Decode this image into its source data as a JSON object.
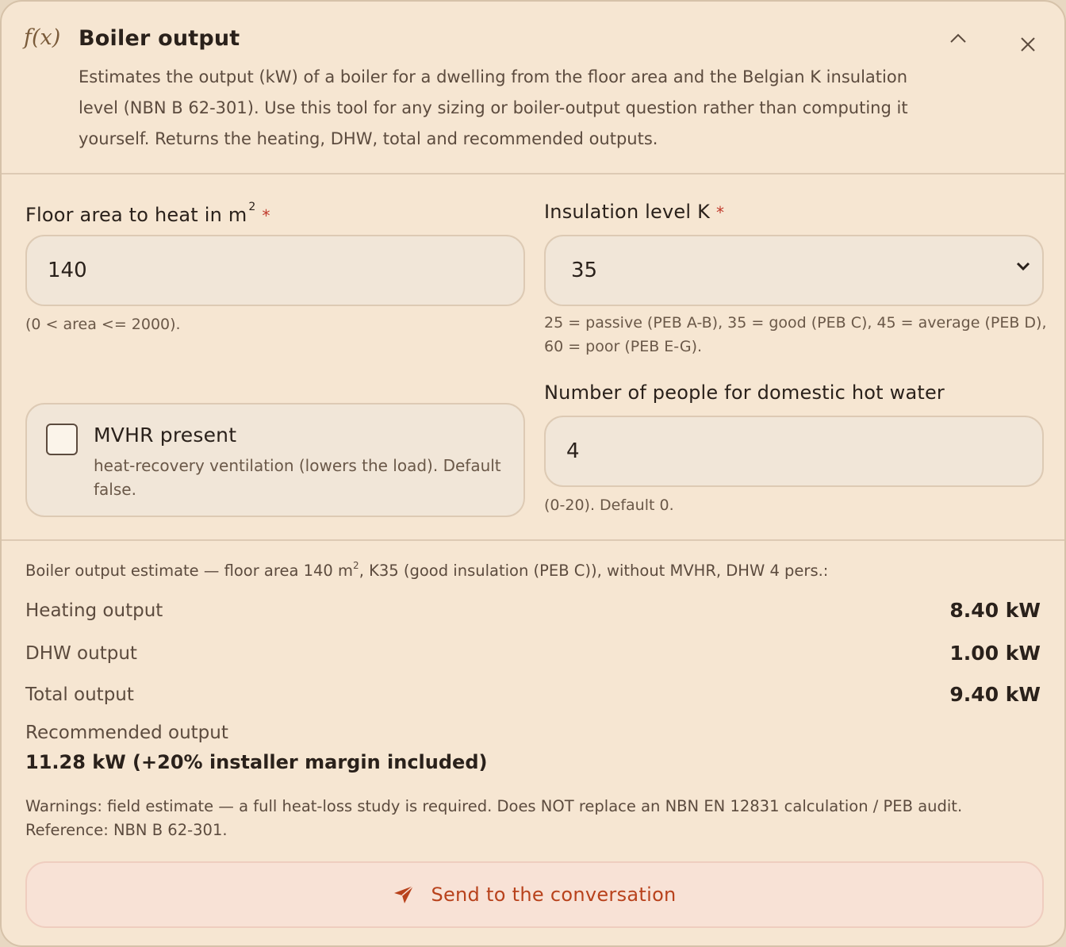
{
  "header": {
    "fx": "f(x)",
    "title": "Boiler output",
    "description": "Estimates the output (kW) of a boiler for a dwelling from the floor area and the Belgian K insulation level (NBN B 62-301). Use this tool for any sizing or boiler-output question rather than computing it yourself. Returns the heating, DHW, total and recommended outputs.",
    "collapse_icon": "chevron-up-icon",
    "close_icon": "close-icon"
  },
  "form": {
    "floor_area": {
      "label": "Floor area to heat in m",
      "sup": "2",
      "required": "*",
      "value": "140",
      "help": "(0 < area <= 2000)."
    },
    "insulation": {
      "label": "Insulation level K",
      "required": "*",
      "value": "35",
      "help_line1": "25 = passive (PEB A-B), 35 = good (PEB C), 45 = average (PEB D),",
      "help_line2": "60 = poor (PEB E-G)."
    },
    "mvhr": {
      "label": "MVHR present",
      "description": "heat-recovery ventilation (lowers the load). Default false.",
      "checked": false
    },
    "people": {
      "label": "Number of people for domestic hot water",
      "value": "4",
      "help": "(0-20). Default 0."
    }
  },
  "results": {
    "summary_prefix": "Boiler output estimate — floor area 140 m",
    "summary_sup": "2",
    "summary_suffix": ", K35 (good insulation (PEB C)), without MVHR, DHW 4 pers.:",
    "rows": [
      {
        "label": "Heating output",
        "value": "8.40 kW"
      },
      {
        "label": "DHW output",
        "value": "1.00 kW"
      },
      {
        "label": "Total output",
        "value": "9.40 kW"
      }
    ],
    "recommended_label": "Recommended output",
    "recommended_value": "11.28 kW (+20% installer margin included)",
    "warnings_line1": "Warnings: field estimate — a full heat-loss study is required. Does NOT replace an NBN EN 12831 calculation / PEB audit.",
    "warnings_line2": "Reference: NBN B 62-301."
  },
  "send_button": {
    "label": "Send to the conversation",
    "icon": "send-icon"
  },
  "colors": {
    "background": "#f6e6d2",
    "accent": "#b8421c",
    "required": "#c0392b"
  }
}
